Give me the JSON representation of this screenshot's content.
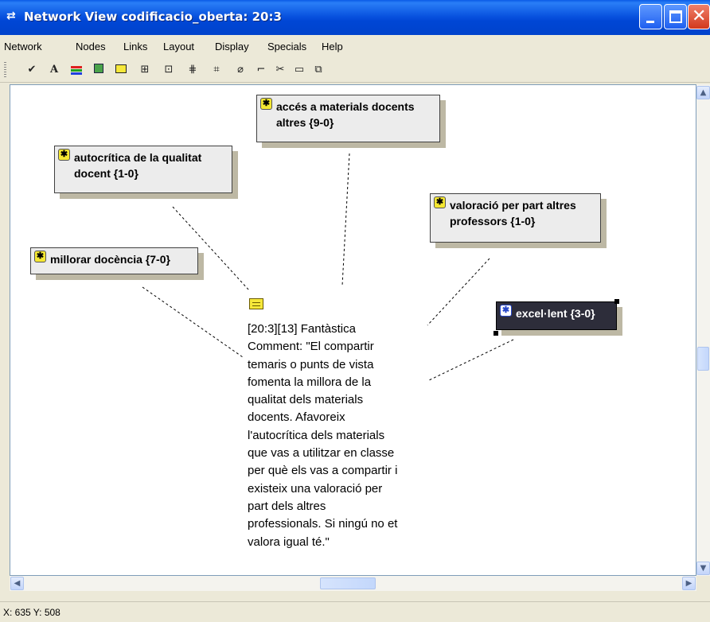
{
  "window": {
    "title": "Network View codificacio_oberta: 20:3"
  },
  "menu": {
    "items": [
      "Network",
      "Nodes",
      "Links",
      "Layout",
      "Display",
      "Specials",
      "Help"
    ]
  },
  "toolbar": {
    "icons": [
      "check-icon",
      "font-icon",
      "colors-icon",
      "display-icon",
      "rectangle-icon",
      "layout-icon",
      "import-icon",
      "network-icon",
      "network-alt-icon",
      "eraser-icon",
      "link-icon",
      "cut-icon",
      "comment-icon",
      "copy-icon"
    ]
  },
  "nodes": {
    "acces": {
      "label": "accés a materials docents\naltres {9-0}"
    },
    "autocritica": {
      "label": "autocrítica de la qualitat\ndocent {1-0}"
    },
    "valoracio": {
      "label": "valoració per part altres\nprofessors {1-0}"
    },
    "millorar": {
      "label": "millorar docència {7-0}"
    },
    "excellent": {
      "label": "excel·lent {3-0}"
    }
  },
  "quotation": {
    "text": "[20:3][13] Fantàstica\nComment: \"El compartir\ntemaris o punts de vista\nfomenta la millora de la\nqualitat dels materials\ndocents. Afavoreix\nl'autocrítica dels materials\nque vas a utilitzar en classe\nper què els vas a compartir i\nexisteix una valoració per\npart dels altres\nprofessionals. Si ningú no et\nvalora igual té.\""
  },
  "statusbar": {
    "coords": "X: 635 Y: 508"
  },
  "colors": {
    "titlebar": "#0046d5",
    "node_background": "#ececec",
    "node_selected": "#2d2d3a",
    "code_icon": "#f5e832"
  }
}
